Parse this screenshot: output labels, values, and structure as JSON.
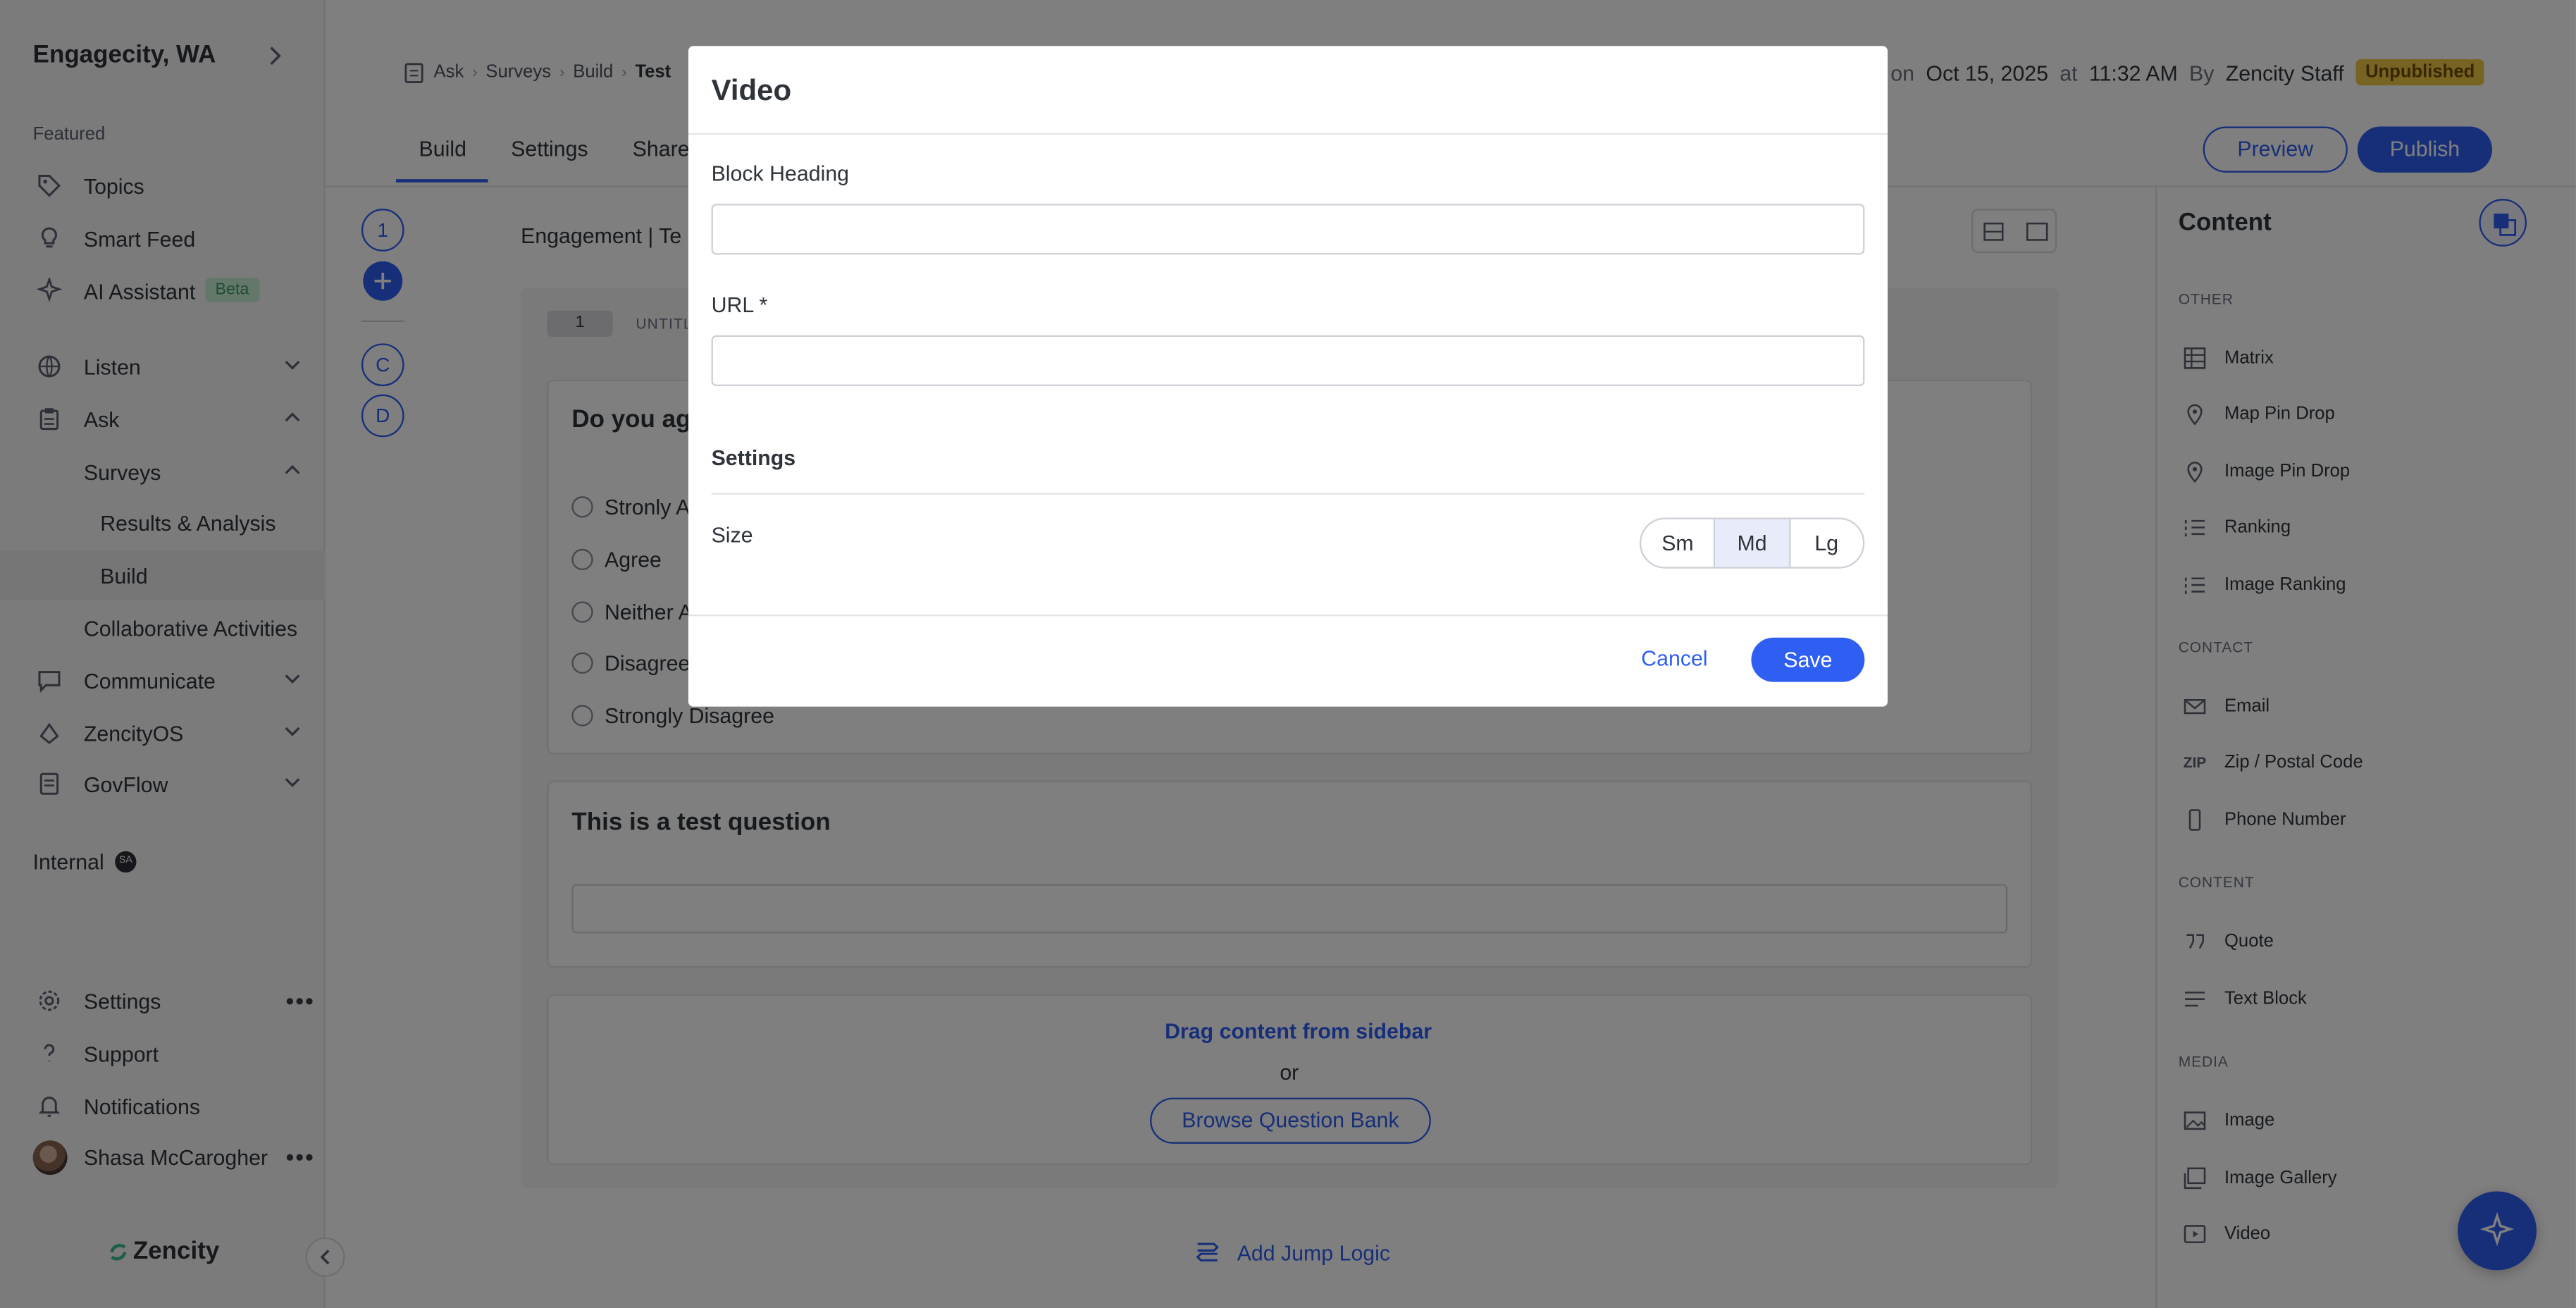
{
  "sidebar": {
    "org": "Engagecity, WA",
    "featured_label": "Featured",
    "featured": [
      {
        "label": "Topics",
        "icon": "tag-icon"
      },
      {
        "label": "Smart Feed",
        "icon": "bulb-icon"
      },
      {
        "label": "AI Assistant",
        "icon": "sparkle-icon",
        "badge": "Beta"
      }
    ],
    "groups": [
      {
        "label": "Listen",
        "icon": "globe-icon"
      },
      {
        "label": "Ask",
        "icon": "clipboard-icon"
      },
      {
        "label": "Communicate",
        "icon": "chat-icon"
      },
      {
        "label": "ZencityOS",
        "icon": "os-icon"
      },
      {
        "label": "GovFlow",
        "icon": "flow-icon"
      }
    ],
    "ask_sub": {
      "surveys": "Surveys",
      "results": "Results & Analysis",
      "build": "Build",
      "collab": "Collaborative Activities"
    },
    "internal": "Internal",
    "internal_badge": "SA",
    "bottom": [
      {
        "label": "Settings",
        "icon": "gear-icon"
      },
      {
        "label": "Support",
        "icon": "question-icon"
      },
      {
        "label": "Notifications",
        "icon": "bell-icon"
      }
    ],
    "user": "Shasa McCarogher",
    "logo": "Zencity"
  },
  "header": {
    "breadcrumb": [
      "Ask",
      "Surveys",
      "Build",
      "Test"
    ],
    "meta": {
      "prefix": "d on",
      "date": "Oct 15, 2025",
      "at": "at",
      "time": "11:32 AM",
      "by": "By",
      "author": "Zencity Staff",
      "status": "Unpublished"
    },
    "tabs": [
      "Build",
      "Settings",
      "Share"
    ],
    "preview": "Preview",
    "publish": "Publish"
  },
  "rail": {
    "page1": "1",
    "c": "C",
    "d": "D"
  },
  "canvas": {
    "section": "Engagement  |  Te",
    "page_num": "1",
    "untitled": "UNTITL",
    "question1": "Do you agr",
    "options": [
      "Stronly A",
      "Agree",
      "Neither A",
      "Disagree",
      "Strongly Disagree"
    ],
    "question2": "This is a test question",
    "drag_text": "Drag content from sidebar",
    "or": "or",
    "browse": "Browse Question Bank",
    "jump": "Add Jump Logic"
  },
  "content_panel": {
    "title": "Content",
    "sections": [
      {
        "name": "OTHER",
        "items": [
          {
            "label": "Matrix",
            "icon": "matrix-icon"
          },
          {
            "label": "Map Pin Drop",
            "icon": "pin-icon"
          },
          {
            "label": "Image Pin Drop",
            "icon": "pin-icon"
          },
          {
            "label": "Ranking",
            "icon": "ranking-icon"
          },
          {
            "label": "Image Ranking",
            "icon": "ranking-icon"
          }
        ]
      },
      {
        "name": "CONTACT",
        "items": [
          {
            "label": "Email",
            "icon": "mail-icon"
          },
          {
            "label": "Zip / Postal Code",
            "icon": "zip-icon",
            "glyph": "ZIP"
          },
          {
            "label": "Phone Number",
            "icon": "phone-icon"
          }
        ]
      },
      {
        "name": "CONTENT",
        "items": [
          {
            "label": "Quote",
            "icon": "quote-icon"
          },
          {
            "label": "Text Block",
            "icon": "text-icon"
          }
        ]
      },
      {
        "name": "MEDIA",
        "items": [
          {
            "label": "Image",
            "icon": "image-icon"
          },
          {
            "label": "Image Gallery",
            "icon": "gallery-icon"
          },
          {
            "label": "Video",
            "icon": "video-icon"
          }
        ]
      }
    ]
  },
  "modal": {
    "title": "Video",
    "heading_label": "Block Heading",
    "heading_value": "",
    "url_label": "URL *",
    "url_value": "",
    "settings_label": "Settings",
    "size_label": "Size",
    "sizes": [
      "Sm",
      "Md",
      "Lg"
    ],
    "size_selected": "Md",
    "cancel": "Cancel",
    "save": "Save"
  },
  "colors": {
    "accent": "#2f5ef2",
    "unpublished": "#f0c945",
    "beta": "#c7eed6"
  }
}
